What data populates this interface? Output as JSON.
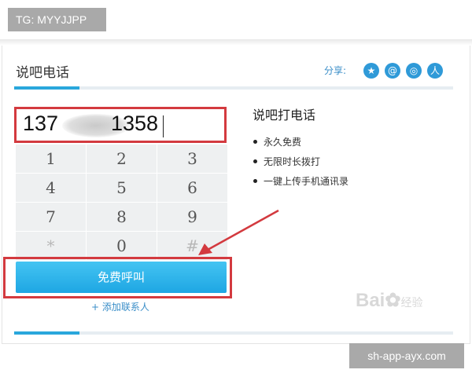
{
  "overlay": {
    "tg_text": "TG: MYYJJPP",
    "site_text": "sh-app-ayx.com"
  },
  "header": {
    "title": "说吧电话",
    "share_label": "分享:"
  },
  "share_icons": [
    {
      "name": "qzone-icon",
      "glyph": "★"
    },
    {
      "name": "tencent-weibo-icon",
      "glyph": "@"
    },
    {
      "name": "sina-weibo-icon",
      "glyph": "◎"
    },
    {
      "name": "renren-icon",
      "glyph": "人"
    }
  ],
  "dialer": {
    "number_prefix": "137",
    "number_suffix": "1358",
    "keys": [
      "1",
      "2",
      "3",
      "4",
      "5",
      "6",
      "7",
      "8",
      "9",
      "*",
      "0",
      "#"
    ],
    "call_label": "免费呼叫",
    "add_contact_label": "+ 添加联系人"
  },
  "sidebar": {
    "title": "说吧打电话",
    "features": [
      "永久免费",
      "无限时长拨打",
      "一键上传手机通讯录"
    ]
  },
  "watermark": {
    "brand": "Bai",
    "suffix": "经验"
  },
  "colors": {
    "accent_blue": "#2aa7dc",
    "highlight_red": "#d33a3f"
  }
}
